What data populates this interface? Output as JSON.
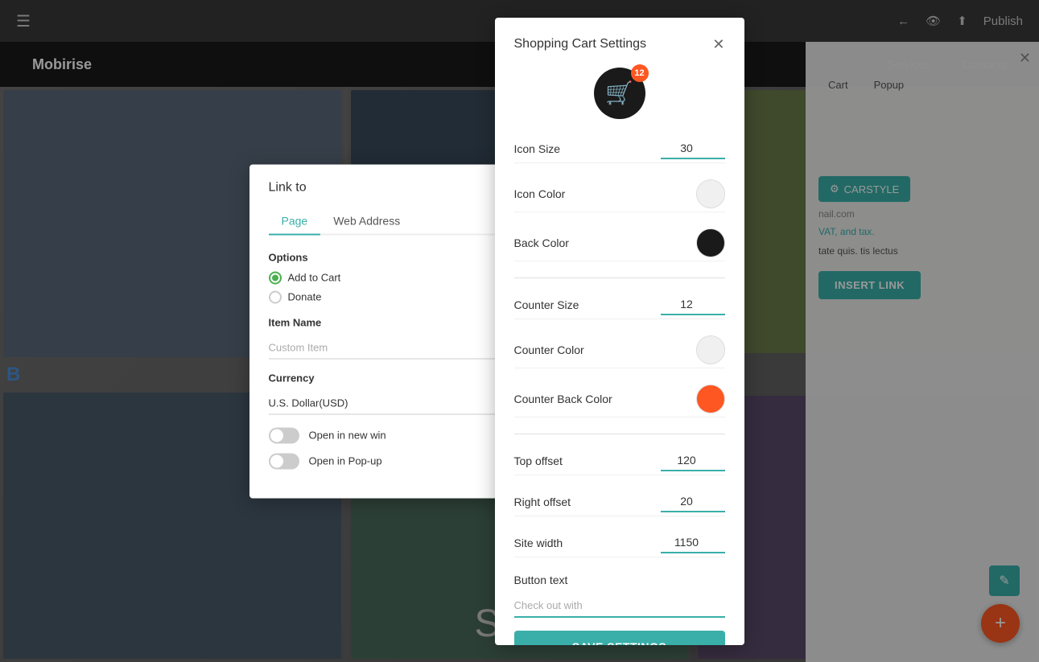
{
  "app": {
    "title": "Mobirise",
    "publish_label": "Publish"
  },
  "topbar": {
    "hamburger": "≡",
    "back_icon": "←",
    "eye_icon": "👁",
    "upload_icon": "⬆",
    "publish_label": "Publish"
  },
  "navbar": {
    "logo": "Mobirise",
    "links": [
      "Services",
      "Contacts"
    ]
  },
  "right_panel": {
    "tabs": [
      "Cart",
      "Popup"
    ],
    "cart_style_label": "CARSTYLE",
    "email_placeholder": "nail.com",
    "tax_text": "VAT, and tax.",
    "desc_text": "tate quis.\ntis lectus",
    "insert_link_label": "INSERT LINK"
  },
  "link_to_dialog": {
    "title": "Link to",
    "tabs": [
      "Page",
      "Web Address"
    ],
    "options_label": "Options",
    "add_to_cart_label": "Add to Cart",
    "donate_label": "Donate",
    "item_name_label": "Item Name",
    "item_name_placeholder": "Custom Item",
    "currency_label": "Currency",
    "currency_value": "U.S. Dollar(USD)",
    "open_new_window_label": "Open in new win",
    "open_popup_label": "Open in Pop-up"
  },
  "cart_settings_dialog": {
    "title": "Shopping Cart Settings",
    "cart_badge_count": "12",
    "icon_size_label": "Icon Size",
    "icon_size_value": "30",
    "icon_color_label": "Icon Color",
    "back_color_label": "Back Color",
    "counter_size_label": "Counter Size",
    "counter_size_value": "12",
    "counter_color_label": "Counter Color",
    "counter_back_color_label": "Counter Back Color",
    "top_offset_label": "Top offset",
    "top_offset_value": "120",
    "right_offset_label": "Right offset",
    "right_offset_value": "20",
    "site_width_label": "Site width",
    "site_width_value": "1150",
    "button_text_label": "Button text",
    "button_text_placeholder": "Check out with",
    "save_settings_label": "SAVE SETTINGS",
    "colors": {
      "icon_color": "#f0f0f0",
      "back_color": "#1a1a1a",
      "counter_color": "#f0f0f0",
      "counter_back_color": "#ff5722"
    }
  },
  "bg_text": {
    "shop": "Shop"
  }
}
